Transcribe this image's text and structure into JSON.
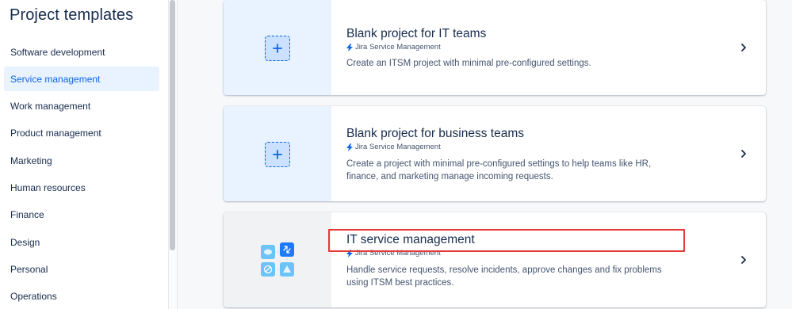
{
  "sidebar": {
    "title": "Project templates",
    "items": [
      {
        "label": "Software development"
      },
      {
        "label": "Service management",
        "selected": true
      },
      {
        "label": "Work management"
      },
      {
        "label": "Product management"
      },
      {
        "label": "Marketing"
      },
      {
        "label": "Human resources"
      },
      {
        "label": "Finance"
      },
      {
        "label": "Design"
      },
      {
        "label": "Personal"
      },
      {
        "label": "Operations"
      }
    ]
  },
  "cards": [
    {
      "title": "Blank project for IT teams",
      "product": "Jira Service Management",
      "description": "Create an ITSM project with minimal pre-configured settings.",
      "icon": "plus-icon"
    },
    {
      "title": "Blank project for business teams",
      "product": "Jira Service Management",
      "description": "Create a project with minimal pre-configured settings to help teams like HR, finance, and marketing manage incoming requests.",
      "icon": "plus-icon"
    },
    {
      "title": "IT service management",
      "product": "Jira Service Management",
      "description": "Handle service requests, resolve incidents, approve changes and fix problems using ITSM best practices.",
      "icon": "itsm-illustration-icon"
    }
  ],
  "colors": {
    "accent": "#0c66e4",
    "selected_bg": "#e9f2ff",
    "highlight": "#e53935"
  }
}
